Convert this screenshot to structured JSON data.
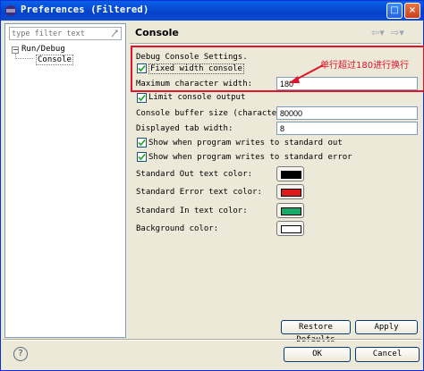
{
  "window": {
    "title": "Preferences (Filtered)"
  },
  "filter": {
    "placeholder": "type filter text"
  },
  "tree": {
    "parent": "Run/Debug",
    "child": "Console"
  },
  "page": {
    "title": "Console"
  },
  "settings": {
    "section_label": "Debug Console Settings.",
    "fixed_width": {
      "label": "Fixed width console",
      "checked": true
    },
    "max_width": {
      "label": "Maximum character width:",
      "value": "180"
    },
    "limit_output": {
      "label": "Limit console output",
      "checked": true
    },
    "buffer_size": {
      "label": "Console buffer size (characters):",
      "value": "80000"
    },
    "tab_width": {
      "label": "Displayed tab width:",
      "value": "8"
    },
    "show_stdout": {
      "label": "Show when program writes to standard out",
      "checked": true
    },
    "show_stderr": {
      "label": "Show when program writes to standard error",
      "checked": true
    },
    "std_out_color": {
      "label": "Standard Out text color:",
      "color": "#000000"
    },
    "std_err_color": {
      "label": "Standard Error text color:",
      "color": "#e01a1a"
    },
    "std_in_color": {
      "label": "Standard In text color:",
      "color": "#19a868"
    },
    "bg_color": {
      "label": "Background color:",
      "color": "#ffffff"
    }
  },
  "annotation": {
    "text": "单行超过180进行换行"
  },
  "buttons": {
    "restore": "Restore Defaults",
    "apply": "Apply",
    "ok": "OK",
    "cancel": "Cancel"
  }
}
